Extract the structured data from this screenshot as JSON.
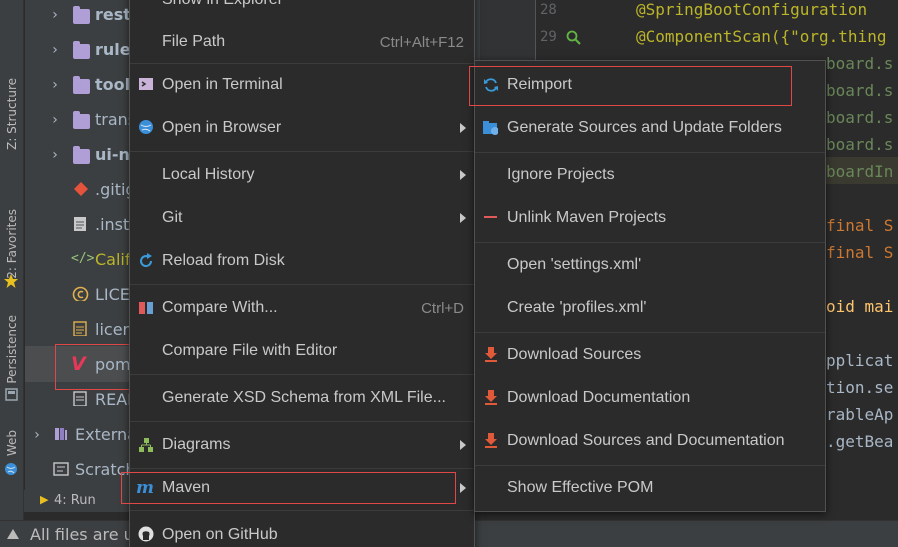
{
  "toolstrip": {
    "tabs": [
      {
        "label": "Z: Structure",
        "icon": "structure-icon"
      },
      {
        "label": "2: Favorites",
        "icon": "star-icon"
      },
      {
        "label": "Persistence",
        "icon": "persistence-icon"
      },
      {
        "label": "Web",
        "icon": "globe-icon"
      }
    ]
  },
  "tree": {
    "items": [
      {
        "label": "rest-",
        "type": "folder",
        "expandable": true
      },
      {
        "label": "rule-",
        "type": "folder",
        "expandable": true
      },
      {
        "label": "tool",
        "type": "folder",
        "expandable": true
      },
      {
        "label": "trans",
        "type": "folder",
        "expandable": true
      },
      {
        "label": "ui-ng",
        "type": "folder",
        "expandable": true
      },
      {
        "label": ".gitig",
        "type": "git-file"
      },
      {
        "label": ".insta",
        "type": "text-file"
      },
      {
        "label": "Califo",
        "type": "code-file"
      },
      {
        "label": "LICE",
        "type": "copyright-file"
      },
      {
        "label": "licen",
        "type": "text-file"
      },
      {
        "label": "pom",
        "type": "maven-file"
      },
      {
        "label": "READ",
        "type": "markdown-file"
      },
      {
        "label": "Externa",
        "type": "library",
        "expandable": true
      },
      {
        "label": "Scratch",
        "type": "scratch"
      }
    ]
  },
  "editor": {
    "lines": [
      {
        "num": "28",
        "text": "@SpringBootConfiguration"
      },
      {
        "num": "29",
        "text": "@ComponentScan({\"org.thing"
      }
    ],
    "fragments": [
      "\"org.thin",
      "board.s",
      "board.s",
      "board.s",
      "board.s",
      "boardIn",
      "final S",
      "final S",
      "oid mai",
      "pplicat",
      "tion.se",
      "rableAp",
      ".getBea"
    ]
  },
  "runbar": {
    "label": "4: Run"
  },
  "status": {
    "text": "All files are u"
  },
  "context_menu": {
    "partial_top": "Show in Explorer",
    "items": [
      {
        "label": "File Path",
        "shortcut": "Ctrl+Alt+F12"
      },
      {
        "label": "Open in Terminal",
        "icon": "terminal-icon"
      },
      {
        "label": "Open in Browser",
        "icon": "globe-icon",
        "submenu": true
      },
      {
        "label": "Local History",
        "submenu": true
      },
      {
        "label": "Git",
        "submenu": true
      },
      {
        "label": "Reload from Disk",
        "icon": "reload-icon"
      },
      {
        "label": "Compare With...",
        "icon": "compare-icon",
        "shortcut": "Ctrl+D"
      },
      {
        "label": "Compare File with Editor"
      },
      {
        "label": "Generate XSD Schema from XML File..."
      },
      {
        "label": "Diagrams",
        "icon": "diagram-icon",
        "submenu": true
      },
      {
        "label": "Maven",
        "icon": "maven-icon",
        "submenu": true
      },
      {
        "label": "Open on GitHub",
        "icon": "github-icon"
      }
    ]
  },
  "maven_menu": {
    "items": [
      {
        "label": "Reimport",
        "icon": "reimport-icon"
      },
      {
        "label": "Generate Sources and Update Folders",
        "icon": "generate-sources-icon"
      },
      {
        "label": "Ignore Projects"
      },
      {
        "label": "Unlink Maven Projects",
        "icon": "minus-icon"
      },
      {
        "label": "Open 'settings.xml'"
      },
      {
        "label": "Create 'profiles.xml'"
      },
      {
        "label": "Download Sources",
        "icon": "download-icon"
      },
      {
        "label": "Download Documentation",
        "icon": "download-icon"
      },
      {
        "label": "Download Sources and Documentation",
        "icon": "download-icon"
      },
      {
        "label": "Show Effective POM"
      }
    ]
  },
  "colors": {
    "highlight_box": "#e04848",
    "menu_bg": "#2b2b2b",
    "maven_icon": "#3b8fd9",
    "download_icon": "#e05a3a"
  }
}
